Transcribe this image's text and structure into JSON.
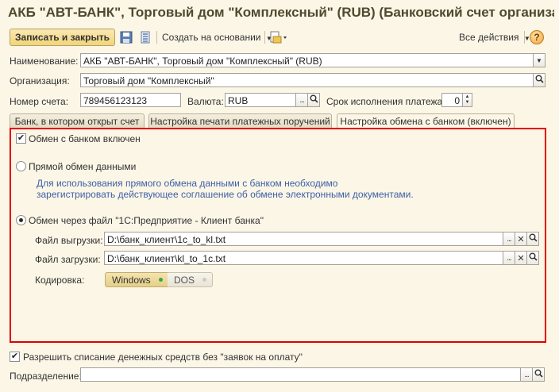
{
  "window": {
    "title": "АКБ \"АВТ-БАНК\", Торговый дом \"Комплексный\" (RUB) (Банковский счет организации)"
  },
  "toolbar": {
    "save_close_label": "Записать и закрыть",
    "create_based_label": "Создать на основании",
    "all_actions_label": "Все действия",
    "help_label": "?"
  },
  "form": {
    "name_label": "Наименование:",
    "name_value": "АКБ \"АВТ-БАНК\", Торговый дом \"Комплексный\" (RUB)",
    "org_label": "Организация:",
    "org_value": "Торговый дом \"Комплексный\"",
    "account_label": "Номер счета:",
    "account_value": "789456123123",
    "currency_label": "Валюта:",
    "currency_value": "RUB",
    "term_label": "Срок исполнения платежа:",
    "term_value": "0"
  },
  "tabs": [
    {
      "label": "Банк, в котором открыт счет"
    },
    {
      "label": "Настройка печати платежных поручений"
    },
    {
      "label": "Настройка обмена с банком (включен)"
    }
  ],
  "exchange": {
    "enabled_label": "Обмен с банком включен",
    "enabled_checked": true,
    "direct_label": "Прямой обмен данными",
    "direct_hint_1": "Для использования прямого обмена данными с банком необходимо",
    "direct_hint_2": "зарегистрировать действующее соглашение об обмене электронными документами.",
    "file_label": "Обмен через файл \"1С:Предприятие - Клиент банка\"",
    "selected_mode": "file",
    "export_label": "Файл выгрузки:",
    "export_value": "D:\\банк_клиент\\1c_to_kl.txt",
    "import_label": "Файл загрузки:",
    "import_value": "D:\\банк_клиент\\kl_to_1c.txt",
    "encoding_label": "Кодировка:",
    "encoding_options": [
      "Windows",
      "DOS"
    ],
    "encoding_selected": "Windows"
  },
  "footer": {
    "allow_label": "Разрешить списание денежных средств без \"заявок на оплату\"",
    "allow_checked": true,
    "division_label": "Подразделение:",
    "division_value": ""
  },
  "colors": {
    "accent_button": "#f1d47a",
    "panel_highlight": "#e00000",
    "hint_text": "#3d5fa8",
    "selected_dot": "#3aa64a"
  }
}
